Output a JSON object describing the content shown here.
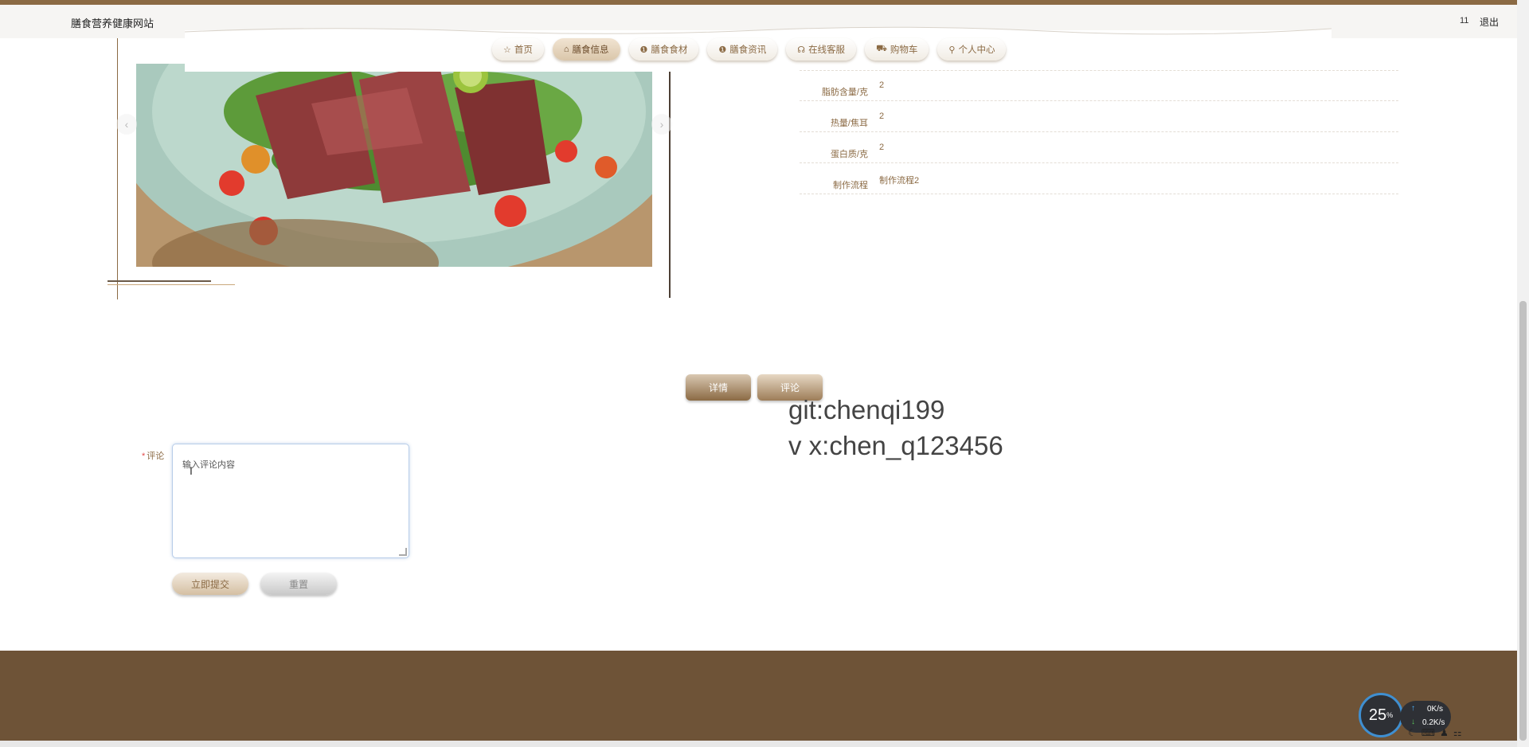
{
  "header": {
    "site_title": "膳食营养健康网站",
    "user_count": "11",
    "logout": "退出"
  },
  "nav": {
    "items": [
      {
        "icon": "star-icon",
        "glyph": "☆",
        "label": "首页",
        "active": false
      },
      {
        "icon": "bag-icon",
        "glyph": "⌂",
        "label": "膳食信息",
        "active": true
      },
      {
        "icon": "info-circle-icon",
        "glyph": "❶",
        "label": "膳食食材",
        "active": false
      },
      {
        "icon": "info-circle-icon",
        "glyph": "❶",
        "label": "膳食资讯",
        "active": false
      },
      {
        "icon": "headset-icon",
        "glyph": "☊",
        "label": "在线客服",
        "active": false
      },
      {
        "icon": "cart-icon",
        "glyph": "⛟",
        "label": "购物车",
        "active": false
      },
      {
        "icon": "user-icon",
        "glyph": "⚲",
        "label": "个人中心",
        "active": false
      }
    ]
  },
  "carousel": {
    "prev": "‹",
    "next": "›"
  },
  "details": [
    {
      "label": "脂肪含量/克",
      "value": "2"
    },
    {
      "label": "热量/焦耳",
      "value": "2"
    },
    {
      "label": "蛋白质/克",
      "value": "2"
    },
    {
      "label": "制作流程",
      "value": "制作流程2"
    }
  ],
  "tabs": [
    {
      "label": "详情",
      "active": false
    },
    {
      "label": "评论",
      "active": true
    }
  ],
  "watermark": {
    "line1": "git:chenqi199",
    "line2": "v x:chen_q123456"
  },
  "comment_form": {
    "required_mark": "*",
    "label": "评论",
    "placeholder": "输入评论内容",
    "submit": "立即提交",
    "reset": "重置"
  },
  "system_widget": {
    "cpu_percent": "25",
    "percent_unit": "%",
    "upload": "0K/s",
    "download": "0.2K/s"
  }
}
